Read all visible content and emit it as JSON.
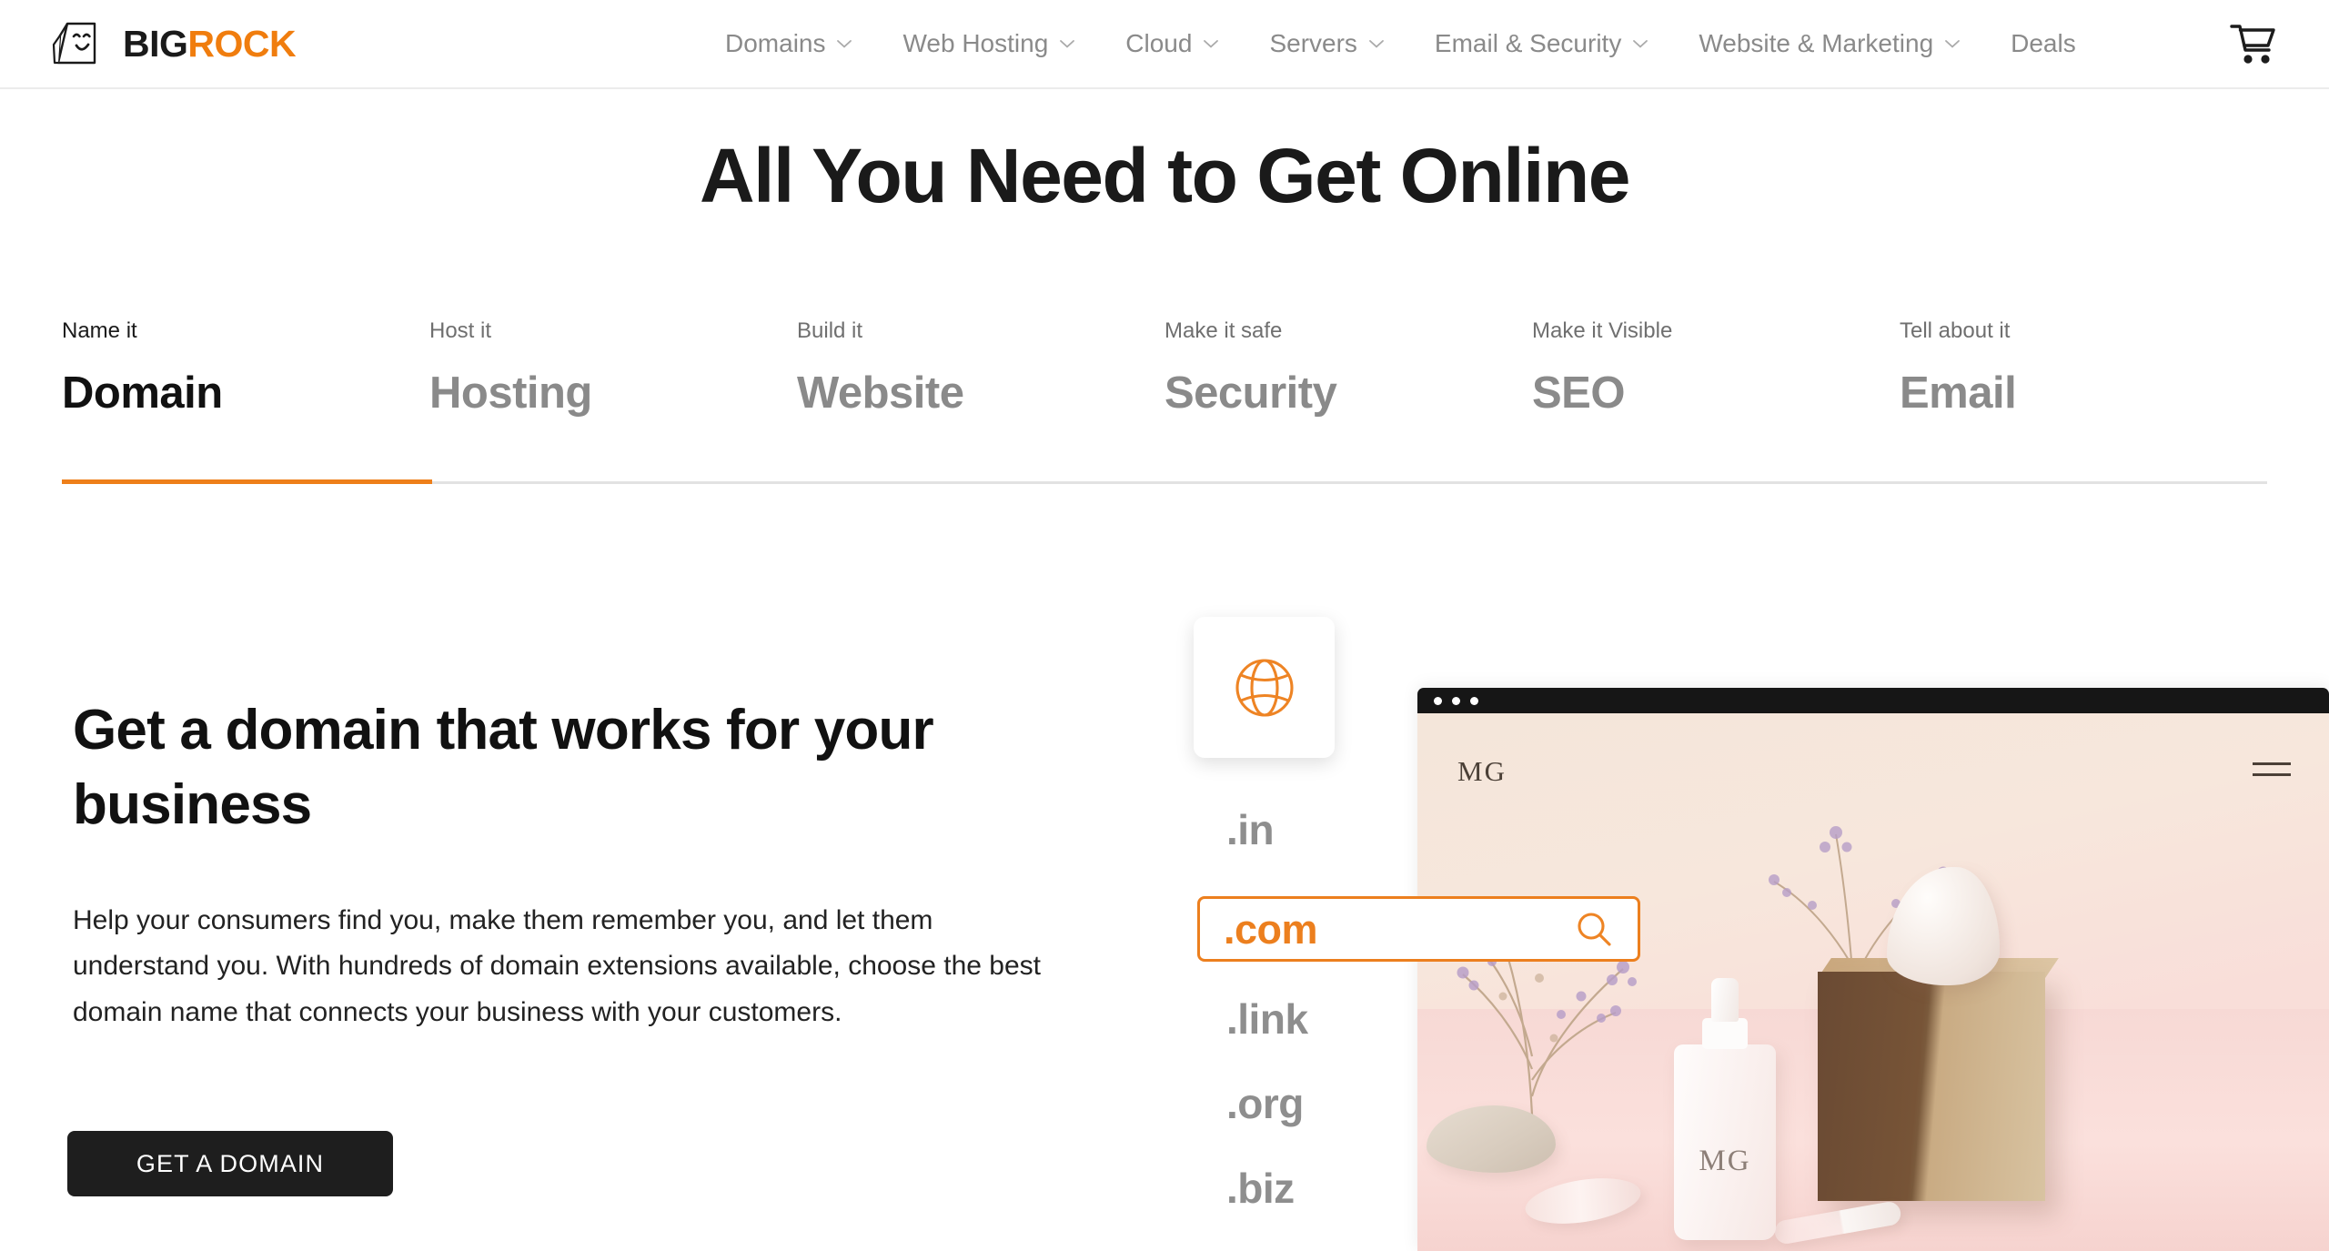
{
  "header": {
    "logo": {
      "big": "BIG",
      "rock": "ROCK",
      "icon": "bigrock-smiley-rock-logo"
    },
    "nav": [
      {
        "label": "Domains",
        "has_dropdown": true
      },
      {
        "label": "Web Hosting",
        "has_dropdown": true
      },
      {
        "label": "Cloud",
        "has_dropdown": true
      },
      {
        "label": "Servers",
        "has_dropdown": true
      },
      {
        "label": "Email & Security",
        "has_dropdown": true
      },
      {
        "label": "Website & Marketing",
        "has_dropdown": true
      },
      {
        "label": "Deals",
        "has_dropdown": false
      }
    ],
    "cart_icon": "shopping-cart-icon"
  },
  "page_title": "All You Need to Get Online",
  "tabs": [
    {
      "kicker": "Name it",
      "label": "Domain",
      "active": true
    },
    {
      "kicker": "Host it",
      "label": "Hosting",
      "active": false
    },
    {
      "kicker": "Build it",
      "label": "Website",
      "active": false
    },
    {
      "kicker": "Make it safe",
      "label": "Security",
      "active": false
    },
    {
      "kicker": "Make it Visible",
      "label": "SEO",
      "active": false
    },
    {
      "kicker": "Tell about it",
      "label": "Email",
      "active": false
    }
  ],
  "panel": {
    "heading": "Get a domain that works for your business",
    "body": "Help your consumers find you, make them remember you, and let them understand you. With hundreds of domain extensions available, choose the best domain name that connects your business with your customers.",
    "cta_label": "GET A DOMAIN"
  },
  "tld_list": {
    "globe_icon": "globe-icon",
    "items": [
      {
        "name": ".in",
        "selected": false
      },
      {
        "name": ".com",
        "selected": true
      },
      {
        "name": ".link",
        "selected": false
      },
      {
        "name": ".org",
        "selected": false
      },
      {
        "name": ".biz",
        "selected": false
      }
    ],
    "search_icon": "search-icon"
  },
  "browser_mockup": {
    "site_logo": "MG",
    "menu_icon": "hamburger-menu-icon",
    "bottle_label": "MG",
    "window_dots": 3
  },
  "colors": {
    "accent_orange": "#ee7f1a",
    "logo_orange": "#f07d0e",
    "text_dark": "#1a1a1a",
    "text_muted": "#8a8a8a",
    "cta_bg": "#1e1e1e"
  }
}
